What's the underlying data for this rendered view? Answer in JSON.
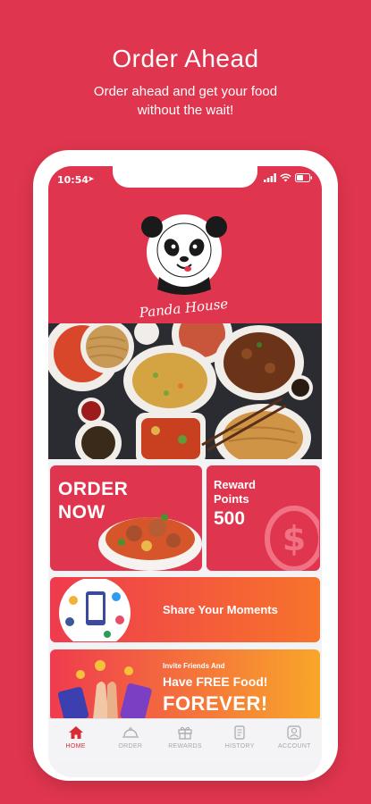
{
  "promo": {
    "title": "Order Ahead",
    "subtitle": "Order ahead and get your food without the wait!"
  },
  "status": {
    "time": "10:54"
  },
  "brand": {
    "name": "Panda House",
    "accent": "#e0354e"
  },
  "cards": {
    "order_title": "ORDER NOW",
    "reward_label": "Reward Points",
    "reward_value": "500",
    "share_label": "Share Your Moments",
    "invite_line1": "Invite Friends And",
    "invite_line2": "Have FREE Food!",
    "invite_line3": "FOREVER!"
  },
  "tabs": [
    {
      "label": "HOME",
      "icon": "home-icon",
      "active": true
    },
    {
      "label": "ORDER",
      "icon": "cloche-icon",
      "active": false
    },
    {
      "label": "REWARDS",
      "icon": "gift-icon",
      "active": false
    },
    {
      "label": "HISTORY",
      "icon": "receipt-icon",
      "active": false
    },
    {
      "label": "ACCOUNT",
      "icon": "user-icon",
      "active": false
    }
  ]
}
